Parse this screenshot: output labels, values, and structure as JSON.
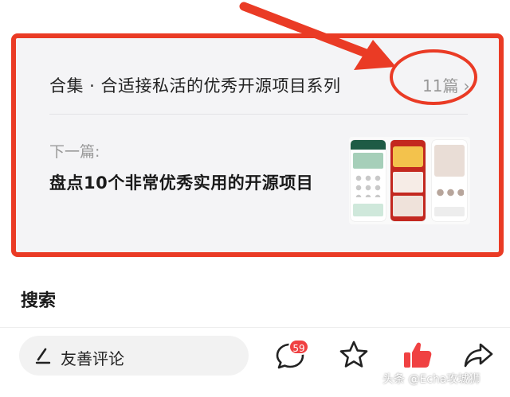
{
  "collection": {
    "title": "合集 · 合适接私活的优秀开源项目系列",
    "count": "11篇",
    "chevron": "›"
  },
  "next": {
    "label": "下一篇:",
    "title": "盘点10个非常优秀实用的开源项目"
  },
  "search": {
    "heading": "搜索"
  },
  "bottom_bar": {
    "comment_placeholder": "友善评论",
    "comment_count": "59"
  },
  "watermark": "头条 @Echa攻城狮",
  "colors": {
    "annotation_red": "#ea3b25",
    "like_red": "#f04142",
    "badge_red": "#f04142"
  },
  "icons": [
    "pen-icon",
    "comment-icon",
    "star-icon",
    "thumbs-up-icon",
    "share-icon",
    "chevron-right-icon"
  ]
}
